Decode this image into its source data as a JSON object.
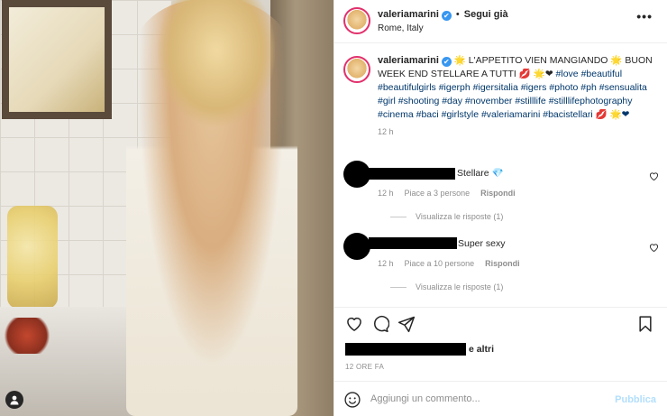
{
  "post": {
    "username": "valeriamarini",
    "verified_mark": "✔",
    "separator": "•",
    "follow_label": "Segui già",
    "location": "Rome, Italy",
    "more_label": "•••"
  },
  "caption": {
    "username": "valeriamarini",
    "text": " 🌟 L'APPETITO VIEN MANGIANDO 🌟 BUON WEEK END STELLARE A TUTTI 💋 🌟❤ ",
    "hashtags": "#love #beautiful #beautifulgirls #igerph #igersitalia #igers #photo #ph #sensualita #girl #shooting #day #november #stilllife #stilllifephotography #cinema #baci #girlstyle #valeriamarini #bacistellari 💋 🌟❤",
    "time": "12 h"
  },
  "comments": [
    {
      "text": "Stellare 💎",
      "time": "12 h",
      "likes": "Piace a 3 persone",
      "reply_label": "Rispondi",
      "view_replies": "Visualizza le risposte (1)"
    },
    {
      "text": "Super sexy",
      "time": "12 h",
      "likes": "Piace a 10 persone",
      "reply_label": "Rispondi",
      "view_replies": "Visualizza le risposte (1)"
    }
  ],
  "likes": {
    "suffix": "e altri"
  },
  "post_time": "12 ORE FA",
  "add_comment": {
    "placeholder": "Aggiungi un commento...",
    "publish_label": "Pubblica"
  },
  "icons": {
    "like": "heart-icon",
    "comment": "comment-icon",
    "share": "share-icon",
    "save": "bookmark-icon",
    "emoji": "emoji-icon",
    "tagged": "user-tag-icon"
  },
  "colors": {
    "link": "#00376b",
    "verified": "#3897f0",
    "publish_disabled": "#b2dffc",
    "secondary_text": "#8e8e8e"
  }
}
